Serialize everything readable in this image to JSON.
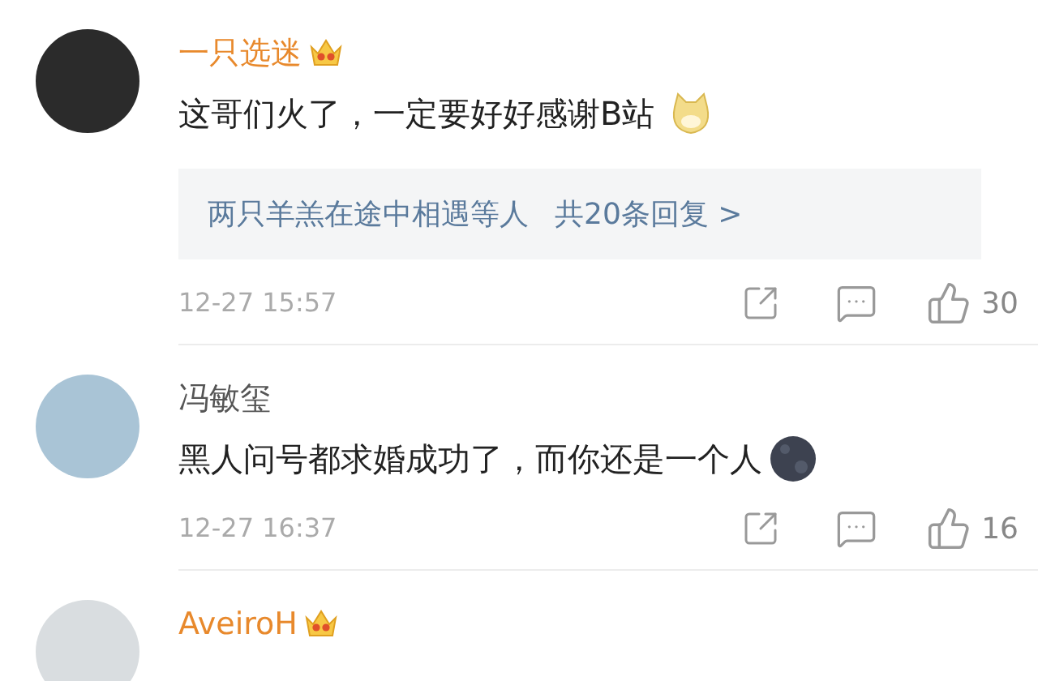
{
  "comments": [
    {
      "name": "一只选迷",
      "vip": true,
      "avatar": {
        "color": "#2b2b2b"
      },
      "text": "这哥们火了，一定要好好感谢B站",
      "emoji": {
        "kind": "dog"
      },
      "replies": {
        "names": "两只羊羔在途中相遇等人",
        "count": "共20条回复 >"
      },
      "time": "12-27 15:57",
      "likes": "30"
    },
    {
      "name": "冯敏玺",
      "vip": false,
      "avatar": {
        "color": "#a9c4d6"
      },
      "text": "黑人问号都求婚成功了，而你还是一个人",
      "emoji": {
        "kind": "moon"
      },
      "time": "12-27 16:37",
      "likes": "16"
    },
    {
      "name": "AveiroH",
      "vip": true,
      "avatar": {
        "color": "#d9dde0"
      }
    }
  ]
}
